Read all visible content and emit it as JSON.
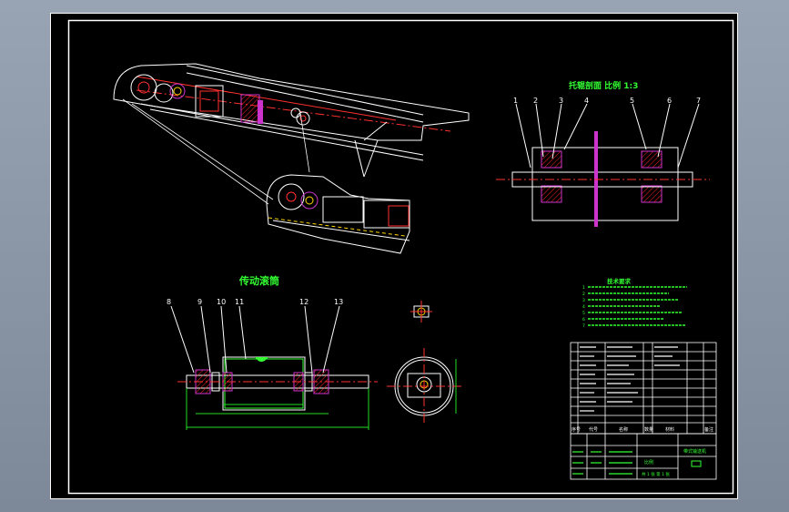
{
  "colors": {
    "background": "#8c98a8",
    "paper": "#000000",
    "frame": "#ffffff",
    "title_green": "#33ff33",
    "centerline_red": "#ff3030",
    "part_magenta": "#cc33cc",
    "dim_green": "#22dd22",
    "hatch_red": "#ff2020"
  },
  "views": {
    "idler_section": {
      "title": "托辊剖面  比例 1:3",
      "balloons": [
        "1",
        "2",
        "3",
        "4",
        "5",
        "6",
        "7"
      ]
    },
    "drive_pulley": {
      "title": "传动滚筒",
      "balloons": [
        "8",
        "9",
        "10",
        "11",
        "12",
        "13"
      ]
    }
  },
  "tech_requirements": {
    "title": "技术要求",
    "lines": [
      "1",
      "2",
      "3",
      "4",
      "5",
      "6",
      "7"
    ]
  },
  "title_block": {
    "col_headers": [
      "序号",
      "代号",
      "名称",
      "数量",
      "材料",
      "备注"
    ],
    "drawing_name": "带式输送机",
    "scale_label": "比例",
    "sheet_label": "共 1 张  第 1 张"
  }
}
